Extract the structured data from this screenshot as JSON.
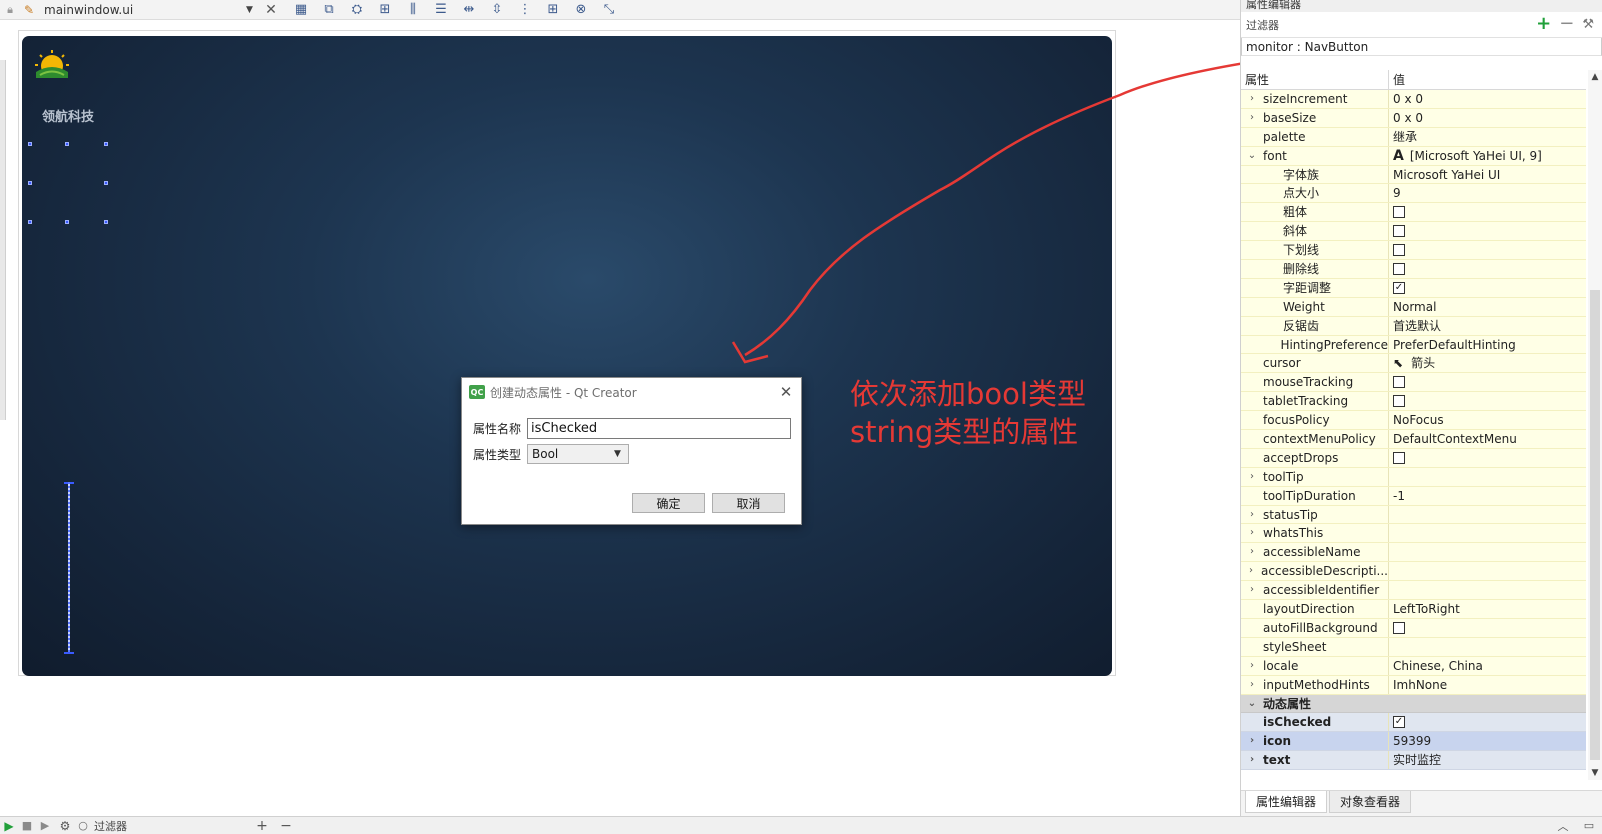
{
  "toolbar": {
    "file_name": "mainwindow.ui",
    "icons": [
      "lock-icon",
      "edit-widgets-icon",
      "edit-signals-icon",
      "edit-buddies-icon",
      "edit-tab-order-icon",
      "layout-horizontal-icon",
      "layout-vertical-icon",
      "splitter-horizontal-icon",
      "splitter-vertical-icon",
      "layout-form-icon",
      "layout-grid-icon",
      "break-layout-icon",
      "adjust-size-icon"
    ]
  },
  "form": {
    "brand_text": "领航科技"
  },
  "dialog": {
    "title": "创建动态属性 - Qt Creator",
    "name_label": "属性名称",
    "name_value": "isChecked",
    "type_label": "属性类型",
    "type_value": "Bool",
    "ok_label": "确定",
    "cancel_label": "取消"
  },
  "annotation": {
    "line1": "依次添加bool类型",
    "line2": "string类型的属性",
    "color": "#e53935"
  },
  "panel": {
    "title": "属性编辑器",
    "filter_label": "过滤器",
    "object_line": "monitor : NavButton",
    "col_property": "属性",
    "col_value": "值",
    "rows": [
      {
        "name": "sizeIncrement",
        "value": "0 x 0",
        "kind": "exp"
      },
      {
        "name": "baseSize",
        "value": "0 x 0",
        "kind": "exp"
      },
      {
        "name": "palette",
        "value": "继承",
        "kind": "plain"
      },
      {
        "name": "font",
        "value": "[Microsoft YaHei UI, 9]",
        "kind": "open"
      },
      {
        "name": "字体族",
        "value": "Microsoft YaHei UI",
        "kind": "sub"
      },
      {
        "name": "点大小",
        "value": "9",
        "kind": "sub"
      },
      {
        "name": "粗体",
        "value": "",
        "kind": "sub-cb"
      },
      {
        "name": "斜体",
        "value": "",
        "kind": "sub-cb"
      },
      {
        "name": "下划线",
        "value": "",
        "kind": "sub-cb"
      },
      {
        "name": "删除线",
        "value": "",
        "kind": "sub-cb"
      },
      {
        "name": "字距调整",
        "value": "✓",
        "kind": "sub-cb"
      },
      {
        "name": "Weight",
        "value": "Normal",
        "kind": "sub"
      },
      {
        "name": "反锯齿",
        "value": "首选默认",
        "kind": "sub"
      },
      {
        "name": "HintingPreference",
        "value": "PreferDefaultHinting",
        "kind": "sub"
      },
      {
        "name": "cursor",
        "value": "箭头",
        "kind": "plain"
      },
      {
        "name": "mouseTracking",
        "value": "",
        "kind": "cb"
      },
      {
        "name": "tabletTracking",
        "value": "",
        "kind": "cb"
      },
      {
        "name": "focusPolicy",
        "value": "NoFocus",
        "kind": "plain"
      },
      {
        "name": "contextMenuPolicy",
        "value": "DefaultContextMenu",
        "kind": "plain"
      },
      {
        "name": "acceptDrops",
        "value": "",
        "kind": "cb"
      },
      {
        "name": "toolTip",
        "value": "",
        "kind": "exp"
      },
      {
        "name": "toolTipDuration",
        "value": "-1",
        "kind": "plain"
      },
      {
        "name": "statusTip",
        "value": "",
        "kind": "exp"
      },
      {
        "name": "whatsThis",
        "value": "",
        "kind": "exp"
      },
      {
        "name": "accessibleName",
        "value": "",
        "kind": "exp"
      },
      {
        "name": "accessibleDescripti...",
        "value": "",
        "kind": "exp"
      },
      {
        "name": "accessibleIdentifier",
        "value": "",
        "kind": "exp"
      },
      {
        "name": "layoutDirection",
        "value": "LeftToRight",
        "kind": "plain"
      },
      {
        "name": "autoFillBackground",
        "value": "",
        "kind": "cb"
      },
      {
        "name": "styleSheet",
        "value": "",
        "kind": "plain"
      },
      {
        "name": "locale",
        "value": "Chinese, China",
        "kind": "exp"
      },
      {
        "name": "inputMethodHints",
        "value": "ImhNone",
        "kind": "exp"
      },
      {
        "name": "动态属性",
        "value": "",
        "kind": "group"
      },
      {
        "name": "isChecked",
        "value": "✓",
        "kind": "dyn-cb"
      },
      {
        "name": "icon",
        "value": "59399",
        "kind": "dyn-exp-sel"
      },
      {
        "name": "text",
        "value": "实时监控",
        "kind": "dyn-exp"
      }
    ],
    "tab_property_editor": "属性编辑器",
    "tab_object_inspector": "对象查看器"
  },
  "bottombar": {
    "filter_placeholder": "过滤器"
  }
}
